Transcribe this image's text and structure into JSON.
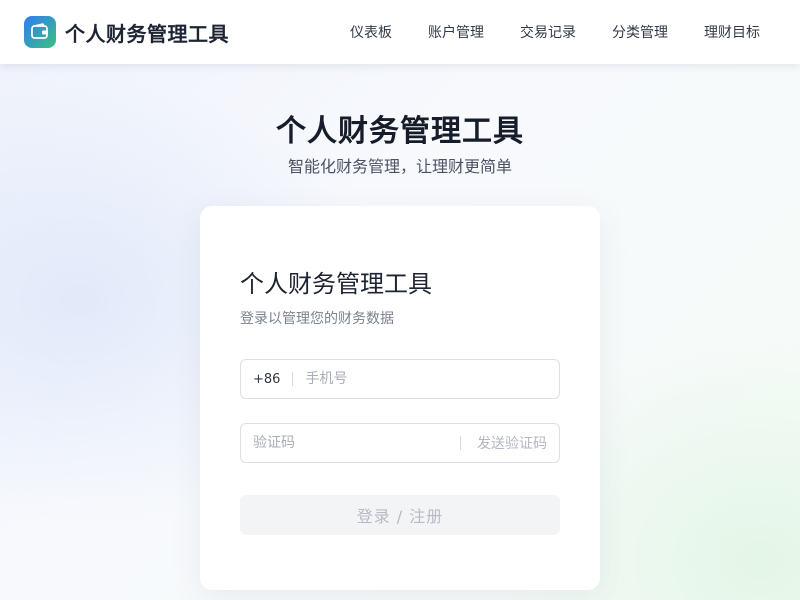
{
  "header": {
    "app_name": "个人财务管理工具",
    "logo_icon": "wallet-icon",
    "nav": [
      {
        "label": "仪表板"
      },
      {
        "label": "账户管理"
      },
      {
        "label": "交易记录"
      },
      {
        "label": "分类管理"
      },
      {
        "label": "理财目标"
      }
    ]
  },
  "hero": {
    "title": "个人财务管理工具",
    "subtitle": "智能化财务管理，让理财更简单"
  },
  "login": {
    "title": "个人财务管理工具",
    "subtitle": "登录以管理您的财务数据",
    "phone_prefix": "+86",
    "phone_placeholder": "手机号",
    "phone_value": "",
    "code_placeholder": "验证码",
    "code_value": "",
    "send_code_label": "发送验证码",
    "submit_label": "登录 / 注册",
    "submit_disabled": true
  },
  "colors": {
    "brand_gradient_start": "#2f7cf6",
    "brand_gradient_end": "#3cc07e",
    "text_primary": "#161c29",
    "text_secondary": "#7b8290",
    "button_disabled_bg": "#f3f4f6",
    "button_disabled_text": "#b7bbc3"
  }
}
